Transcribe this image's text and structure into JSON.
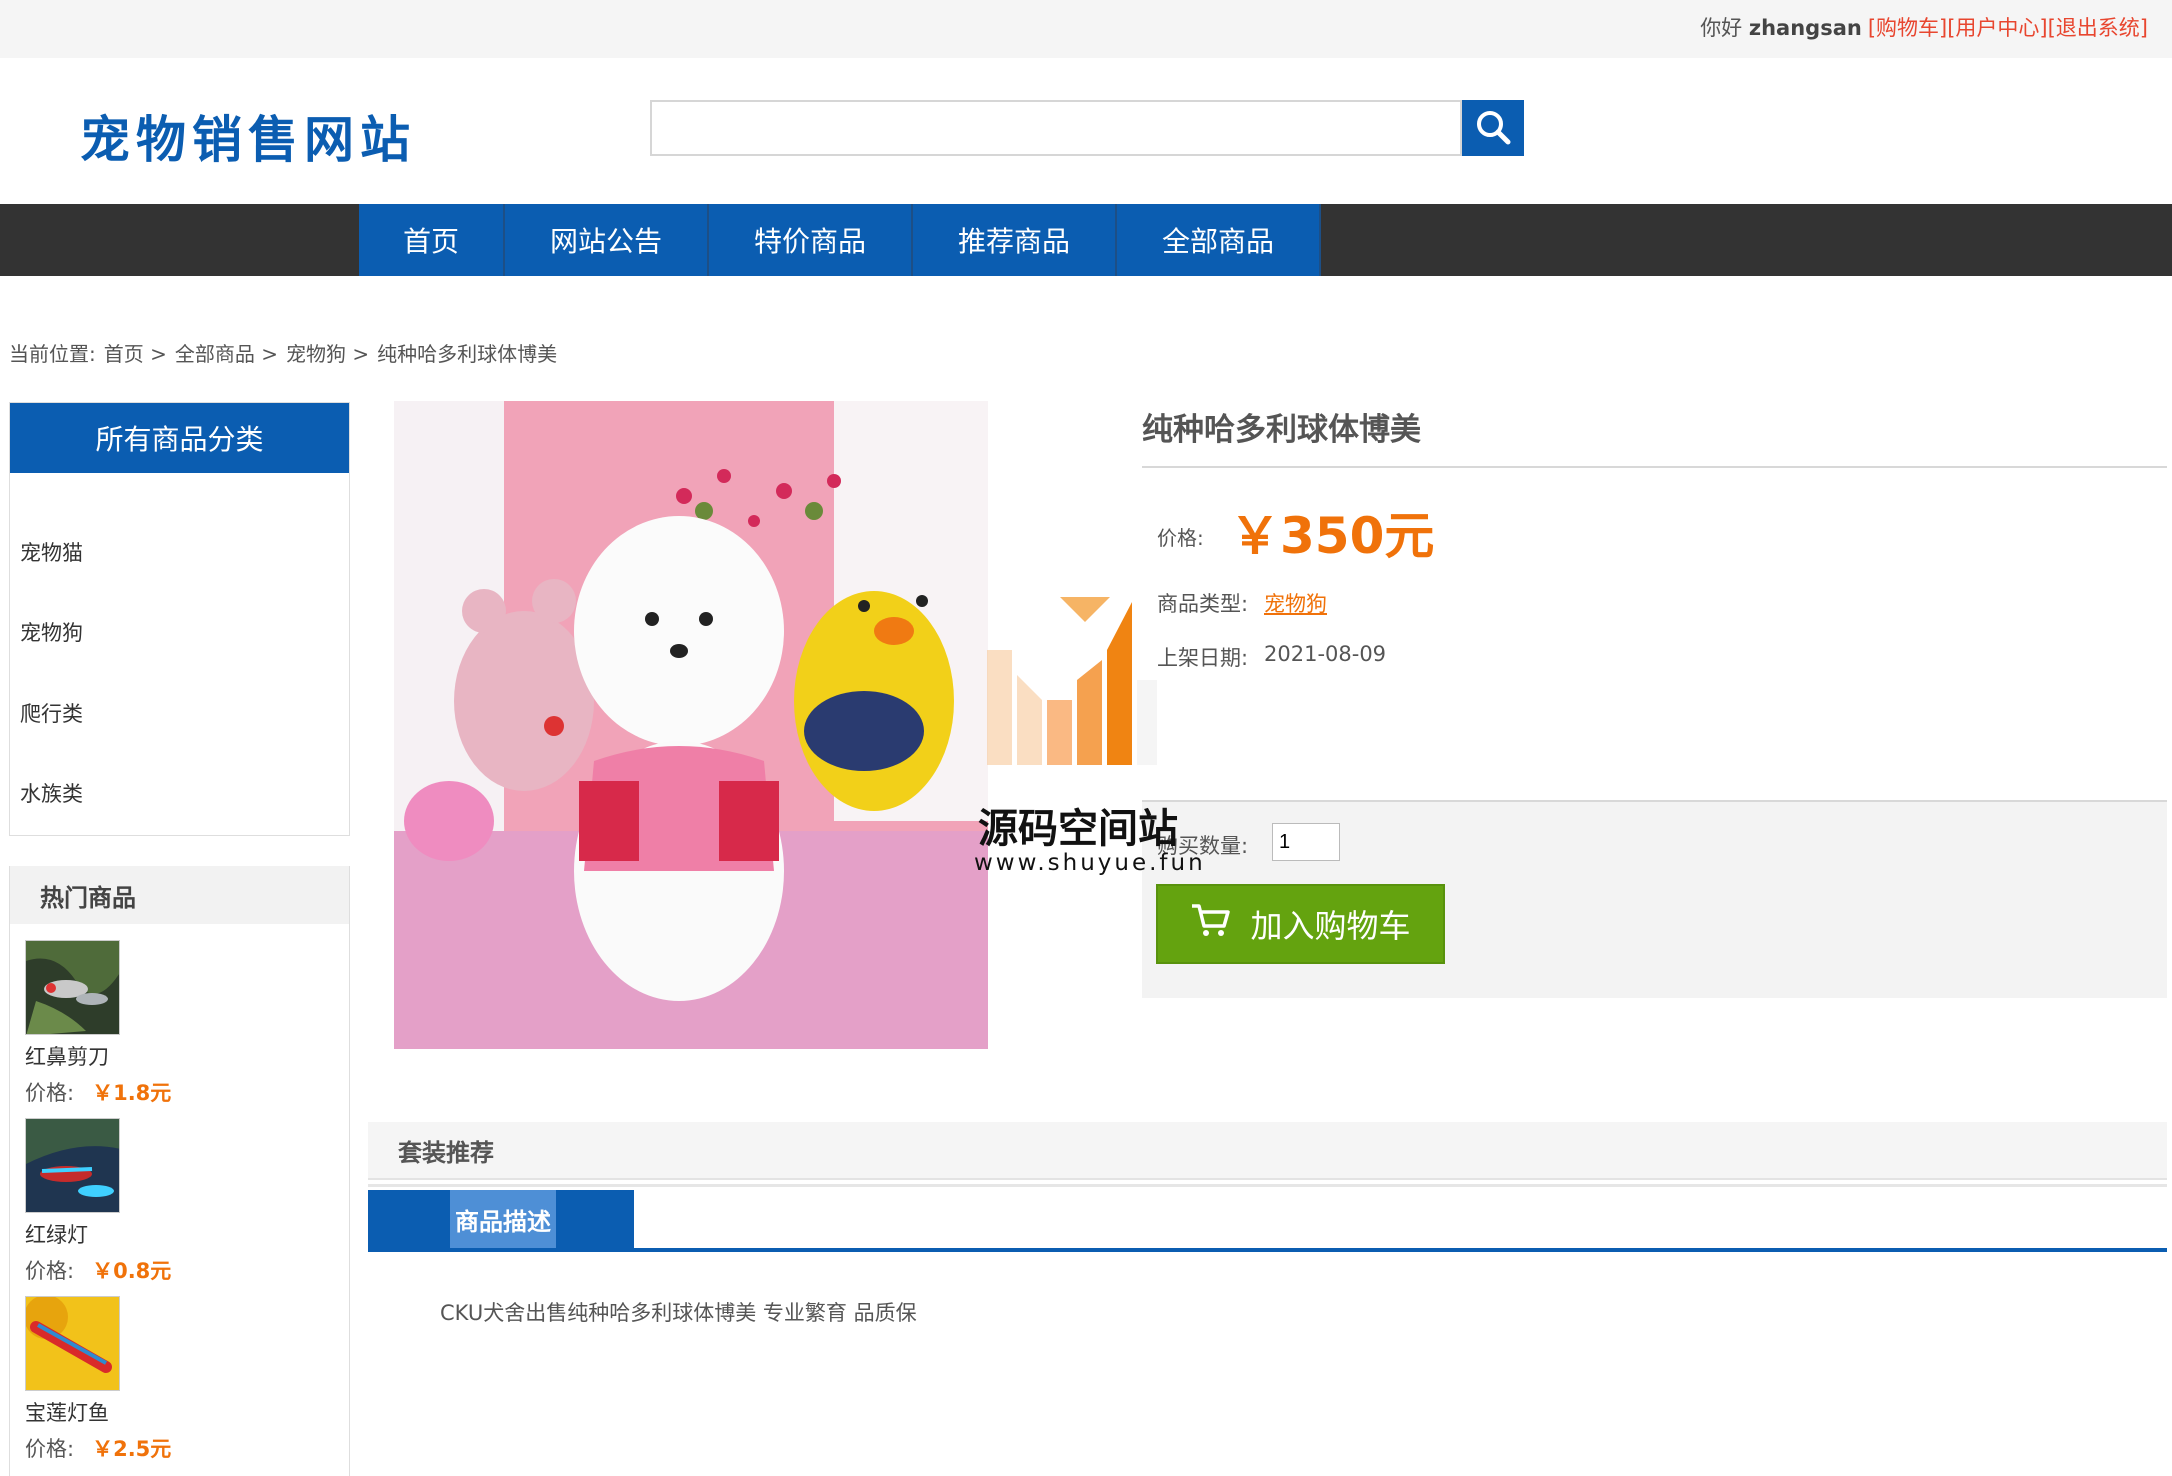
{
  "topbar": {
    "greeting": "你好",
    "username": "zhangsan",
    "links": [
      "[购物车]",
      "[用户中心]",
      "[退出系统]"
    ]
  },
  "header": {
    "site_name": "宠物销售网站",
    "search_placeholder": ""
  },
  "nav": {
    "items": [
      "首页",
      "网站公告",
      "特价商品",
      "推荐商品",
      "全部商品"
    ]
  },
  "breadcrumb": {
    "prefix": "当前位置:",
    "items": [
      "首页 >",
      "全部商品 >",
      "宠物狗 >",
      "纯种哈多利球体博美"
    ]
  },
  "sidebar": {
    "category_title": "所有商品分类",
    "categories": [
      "宠物猫",
      "宠物狗",
      "爬行类",
      "水族类"
    ],
    "hot_title": "热门商品",
    "hot_items": [
      {
        "name": "红鼻剪刀",
        "price_label": "价格:",
        "price": "￥1.8元"
      },
      {
        "name": "红绿灯",
        "price_label": "价格:",
        "price": "￥0.8元"
      },
      {
        "name": "宝莲灯鱼",
        "price_label": "价格:",
        "price": "￥2.5元"
      }
    ]
  },
  "product": {
    "name": "纯种哈多利球体博美",
    "price_label": "价格:",
    "price": "￥350元",
    "type_label": "商品类型:",
    "type_value": "宠物狗",
    "date_label": "上架日期:",
    "date_value": "2021-08-09",
    "qty_label": "购买数量:",
    "qty_value": "1",
    "add_to_cart": "加入购物车"
  },
  "watermark": {
    "text": "源码空间站",
    "url": "www.shuyue.fun"
  },
  "tabs": {
    "package_title": "套装推荐",
    "desc_tab": "商品描述",
    "description": "CKU犬舍出售纯种哈多利球体博美 专业繁育 品质保"
  },
  "colors": {
    "brand_blue": "#0b5db1",
    "price_orange": "#f0720a",
    "cart_green": "#64a30f",
    "nav_dark": "#333333",
    "topbar_link_red": "#e8462f"
  },
  "icons": [
    "search-icon",
    "cart-icon"
  ]
}
